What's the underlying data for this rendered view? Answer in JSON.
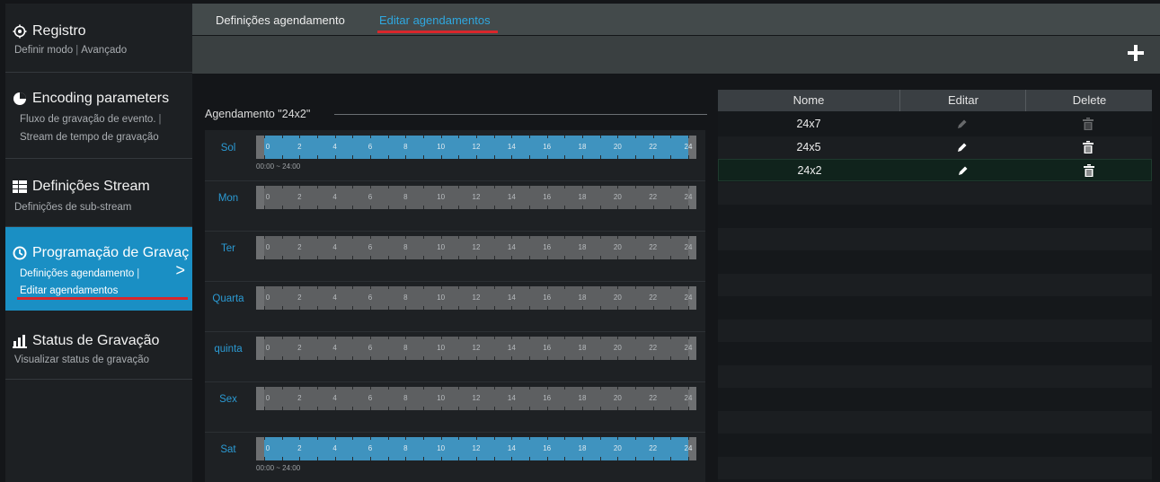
{
  "sidebar": {
    "items": [
      {
        "title": "Registro",
        "sub1": "Definir modo",
        "sub2": "Avançado",
        "icon": "gear-cluster-icon"
      },
      {
        "title": "Encoding parameters",
        "sub1": "Fluxo de gravação de evento.",
        "sub2": "|",
        "sub3": "Stream de tempo de gravação",
        "icon": "pie-chart-icon"
      },
      {
        "title": "Definições Stream",
        "sub1": "Definições de sub-stream",
        "icon": "list-icon"
      },
      {
        "title": "Programação de Gravaç",
        "sub1": "Definições agendamento",
        "sub2": "|",
        "sub3": "Editar agendamentos",
        "icon": "clock-icon",
        "chevron": ">"
      },
      {
        "title": "Status de Gravação",
        "sub1": "Visualizar status de gravação",
        "icon": "bar-status-icon"
      }
    ]
  },
  "tabs": {
    "settings": "Definições agendamento",
    "edit": "Editar agendamentos"
  },
  "toolbar": {
    "add_icon": "plus-icon"
  },
  "schedule": {
    "title": "Agendamento \"24x2\"",
    "hour_labels": [
      "0",
      "2",
      "4",
      "6",
      "8",
      "10",
      "12",
      "14",
      "16",
      "18",
      "20",
      "22",
      "24"
    ],
    "days": [
      {
        "label": "Sol",
        "active": true,
        "range": "00:00 ~ 24:00"
      },
      {
        "label": "Mon",
        "active": false,
        "range": ""
      },
      {
        "label": "Ter",
        "active": false,
        "range": ""
      },
      {
        "label": "Quarta",
        "active": false,
        "range": ""
      },
      {
        "label": "quinta",
        "active": false,
        "range": ""
      },
      {
        "label": "Sex",
        "active": false,
        "range": ""
      },
      {
        "label": "Sat",
        "active": true,
        "range": "00:00 ~ 24:00"
      }
    ]
  },
  "table": {
    "headers": {
      "name": "Nome",
      "edit": "Editar",
      "delete": "Delete"
    },
    "rows": [
      {
        "name": "24x7",
        "enabled": false
      },
      {
        "name": "24x5",
        "enabled": true
      },
      {
        "name": "24x2",
        "enabled": true,
        "selected": true
      }
    ]
  },
  "colors": {
    "accent": "#1a8fc4",
    "tab_active": "#2fa8e0",
    "underline": "#d9262b",
    "bar_fill": "#3f93bf"
  }
}
